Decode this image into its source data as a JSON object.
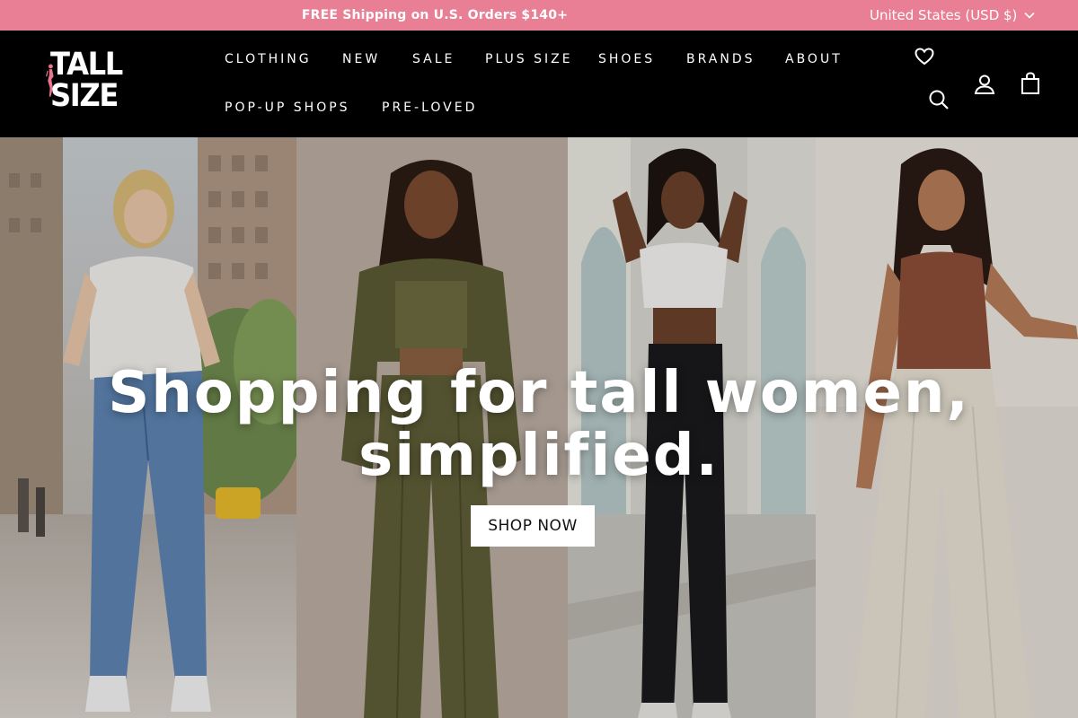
{
  "announcement": {
    "text": "FREE Shipping on U.S. Orders $140+",
    "background": "#e97f95"
  },
  "currency_selector": {
    "label": "United States (USD $)",
    "icon": "chevron-down-icon"
  },
  "brand": {
    "logo_text": "TALL SIZE",
    "accent": "#e9768f"
  },
  "nav": {
    "items": [
      "CLOTHING",
      "NEW",
      "SALE",
      "PLUS SIZE",
      "SHOES",
      "BRANDS",
      "ABOUT",
      "POP-UP SHOPS",
      "PRE-LOVED"
    ]
  },
  "header_icons": {
    "wishlist": "heart-icon",
    "search": "search-icon",
    "account": "user-icon",
    "cart": "shopping-bag-icon"
  },
  "hero": {
    "title_line1": "Shopping for tall women,",
    "title_line2": "simplified.",
    "cta_label": "SHOP NOW"
  }
}
